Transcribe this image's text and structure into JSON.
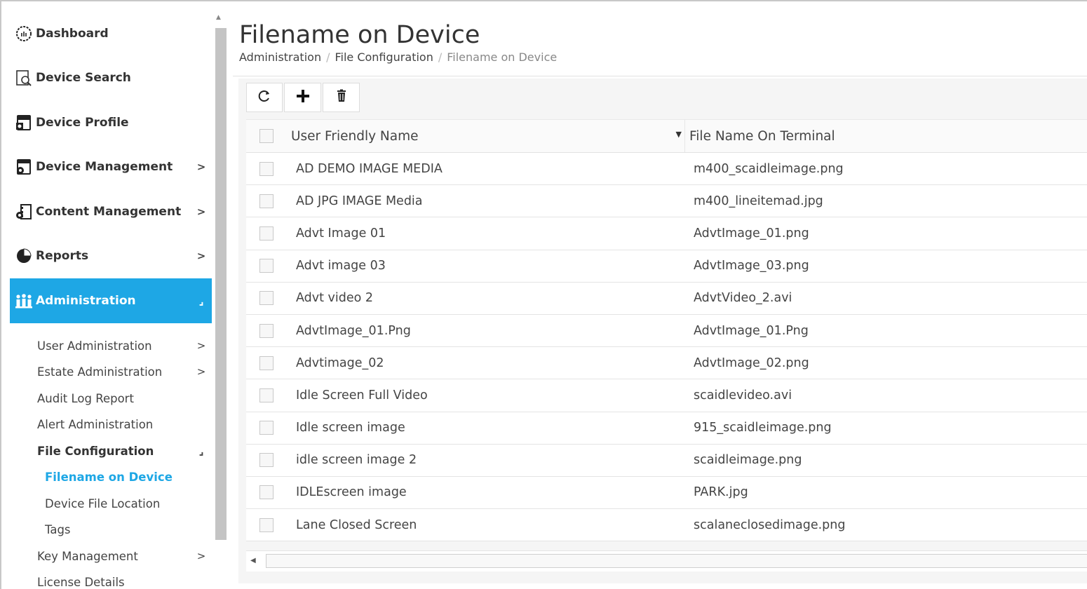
{
  "sidebar": {
    "items": [
      {
        "label": "Dashboard",
        "icon": "dashboard-icon"
      },
      {
        "label": "Device Search",
        "icon": "device-search-icon"
      },
      {
        "label": "Device Profile",
        "icon": "device-profile-icon"
      },
      {
        "label": "Device Management",
        "icon": "device-management-icon",
        "chevron": ">"
      },
      {
        "label": "Content Management",
        "icon": "content-management-icon",
        "chevron": ">"
      },
      {
        "label": "Reports",
        "icon": "reports-icon",
        "chevron": ">"
      },
      {
        "label": "Administration",
        "icon": "administration-icon",
        "chevron": "⌟"
      }
    ],
    "sub_items": [
      {
        "label": "User Administration",
        "chevron": ">"
      },
      {
        "label": "Estate Administration",
        "chevron": ">"
      },
      {
        "label": "Audit Log Report"
      },
      {
        "label": "Alert Administration"
      },
      {
        "label": "File Configuration",
        "chevron": "⌟"
      },
      {
        "label": "Filename on Device"
      },
      {
        "label": "Device File Location"
      },
      {
        "label": "Tags"
      },
      {
        "label": "Key Management",
        "chevron": ">"
      },
      {
        "label": "License Details"
      }
    ],
    "accent_color": "#1ea7e5"
  },
  "page": {
    "title": "Filename on Device",
    "breadcrumb": [
      "Administration",
      "File Configuration",
      "Filename on Device"
    ],
    "breadcrumb_separator": "/"
  },
  "toolbar": {
    "refresh_icon": "refresh-icon",
    "add_icon": "add-icon",
    "delete_icon": "trash-icon"
  },
  "table": {
    "columns": [
      "User Friendly Name",
      "File Name On Terminal"
    ],
    "rows": [
      [
        "AD DEMO IMAGE MEDIA",
        "m400_scaidleimage.png"
      ],
      [
        "AD JPG IMAGE Media",
        "m400_lineitemad.jpg"
      ],
      [
        "Advt Image 01",
        "AdvtImage_01.png"
      ],
      [
        "Advt image 03",
        "AdvtImage_03.png"
      ],
      [
        "Advt video 2",
        "AdvtVideo_2.avi"
      ],
      [
        "AdvtImage_01.Png",
        "AdvtImage_01.Png"
      ],
      [
        "Advtimage_02",
        "AdvtImage_02.png"
      ],
      [
        "Idle Screen Full Video",
        "scaidlevideo.avi"
      ],
      [
        "Idle screen image",
        "915_scaidleimage.png"
      ],
      [
        "idle screen image 2",
        "scaidleimage.png"
      ],
      [
        "IDLEscreen image",
        "PARK.jpg"
      ],
      [
        "Lane Closed Screen",
        "scalaneclosedimage.png"
      ]
    ]
  }
}
